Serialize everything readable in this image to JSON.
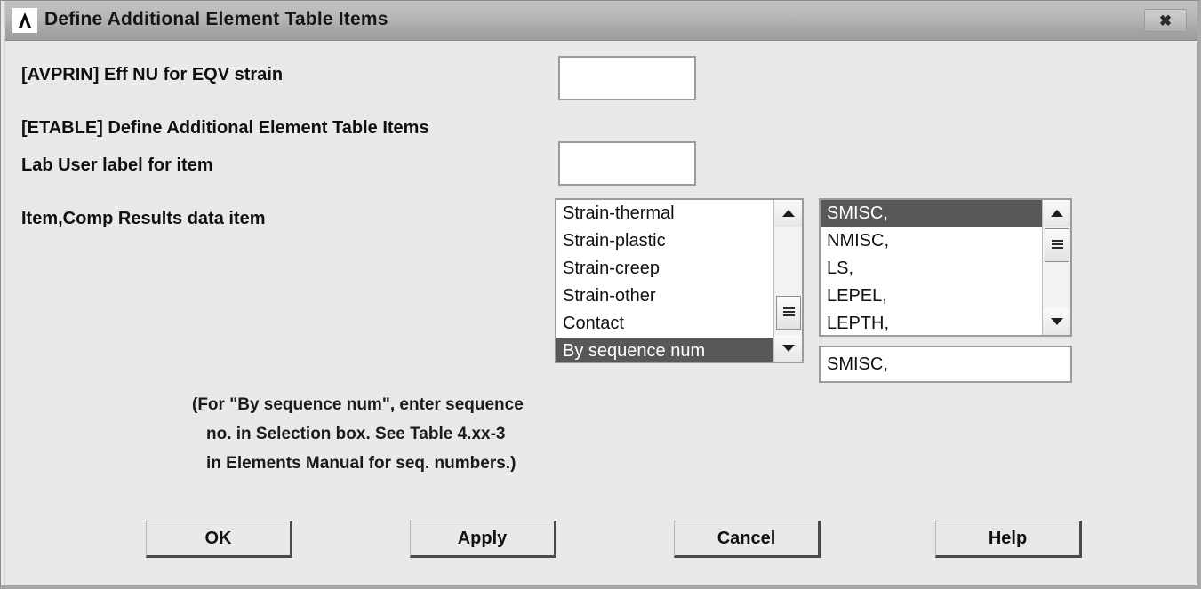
{
  "window": {
    "title": "Define Additional Element Table Items",
    "icon": "ansys-logo-icon",
    "close_label": "✖"
  },
  "form": {
    "avprin": {
      "label": "[AVPRIN]  Eff NU for EQV strain",
      "value": "",
      "placeholder": ""
    },
    "etable": {
      "label": "[ETABLE]  Define Additional Element Table Items"
    },
    "lab": {
      "label": "Lab          User label for item",
      "value": "",
      "placeholder": ""
    },
    "item_comp": {
      "label": "Item,Comp  Results data item"
    }
  },
  "item_list": {
    "items": [
      "Strain-thermal",
      "Strain-plastic",
      "Strain-creep",
      "Strain-other",
      "Contact",
      "By sequence num"
    ],
    "selected_index": 5
  },
  "comp_list": {
    "items": [
      "SMISC,",
      "NMISC,",
      "LS,",
      "LEPEL,",
      "LEPTH,"
    ],
    "selected_index": 0
  },
  "selection_field": {
    "value": "SMISC,",
    "placeholder": ""
  },
  "note": {
    "line1": "(For \"By sequence num\", enter sequence",
    "line2": "no. in Selection box.  See Table 4.xx-3",
    "line3": "in Elements Manual for seq. numbers.)"
  },
  "buttons": {
    "ok": "OK",
    "apply": "Apply",
    "cancel": "Cancel",
    "help": "Help"
  },
  "colors": {
    "dialog_background": "#e9e9e9",
    "titlebar_top": "#c3c3c3",
    "titlebar_bottom": "#9c9c9c",
    "selection_highlight": "#585858",
    "field_background": "#ffffff",
    "border": "#9b9b9b"
  }
}
